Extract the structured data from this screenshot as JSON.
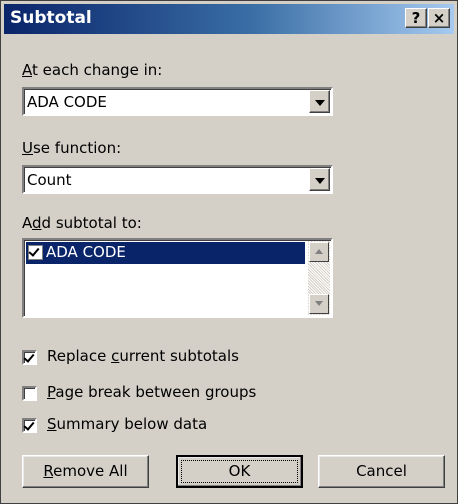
{
  "window": {
    "title": "Subtotal",
    "help_label": "?",
    "close_label": "×"
  },
  "at_each_change": {
    "label_underlined": "A",
    "label_rest": "t each change in:",
    "value": "ADA CODE"
  },
  "use_function": {
    "label_underlined": "U",
    "label_rest": "se function:",
    "value": "Count"
  },
  "add_subtotal": {
    "label_pre": "A",
    "label_underlined": "d",
    "label_rest": "d subtotal to:",
    "items": [
      {
        "label": "ADA CODE",
        "checked": true,
        "selected": true
      }
    ]
  },
  "options": [
    {
      "pre": "Replace ",
      "underlined": "c",
      "rest": "urrent subtotals",
      "checked": true
    },
    {
      "pre": "",
      "underlined": "P",
      "rest": "age break between groups",
      "checked": false
    },
    {
      "pre": "",
      "underlined": "S",
      "rest": "ummary below data",
      "checked": true
    }
  ],
  "buttons": {
    "remove_all_underlined": "R",
    "remove_all_rest": "emove All",
    "ok": "OK",
    "cancel": "Cancel"
  },
  "colors": {
    "dialog_bg": "#d4d0c8",
    "title_gradient_start": "#0a246a",
    "title_gradient_end": "#a6caf0",
    "selection": "#0a246a"
  }
}
